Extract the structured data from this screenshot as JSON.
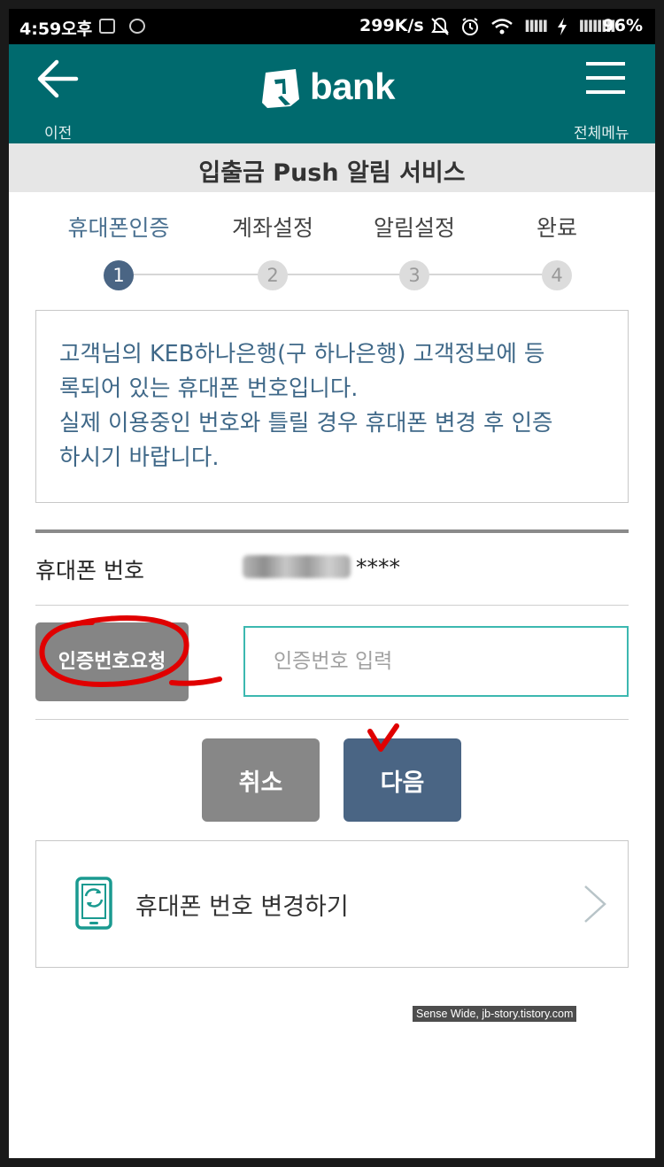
{
  "status_bar": {
    "time": "4:59오후",
    "speed": "299K/s",
    "battery": "96%",
    "signal_text": "IIIII",
    "signal_text2": "IIIIIIII"
  },
  "header": {
    "back_label": "이전",
    "logo_text": "bank",
    "logo_mark": "Q",
    "menu_label": "전체메뉴"
  },
  "page_title": "입출금 Push 알림 서비스",
  "steps": [
    {
      "label": "휴대폰인증",
      "number": "1",
      "active": true
    },
    {
      "label": "계좌설정",
      "number": "2",
      "active": false
    },
    {
      "label": "알림설정",
      "number": "3",
      "active": false
    },
    {
      "label": "완료",
      "number": "4",
      "active": false
    }
  ],
  "info": {
    "line1": "고객님의 KEB하나은행(구 하나은행) 고객정보에 등",
    "line2": "록되어 있는 휴대폰 번호입니다.",
    "line3": "실제 이용중인 번호와 틀릴 경우 휴대폰 변경 후 인증",
    "line4": "하시기 바랍니다."
  },
  "phone": {
    "label": "휴대폰 번호",
    "masked_suffix": "****"
  },
  "verify": {
    "request_label": "인증번호요청",
    "input_placeholder": "인증번호 입력",
    "input_value": ""
  },
  "actions": {
    "cancel_label": "취소",
    "next_label": "다음"
  },
  "change_phone": {
    "label": "휴대폰 번호 변경하기"
  },
  "watermark": "Sense Wide, jb-story.tistory.com",
  "colors": {
    "header_bg": "#006a6e",
    "active_step": "#4a6584",
    "info_text": "#3f6888",
    "input_border": "#3cb8b0",
    "annotation_red": "#e00000"
  },
  "icons": {
    "back": "arrow-left-icon",
    "menu": "hamburger-icon",
    "phone": "phone-exchange-icon",
    "chevron": "chevron-right-icon",
    "silent": "bell-off-icon",
    "alarm": "alarm-clock-icon",
    "wifi": "wifi-icon",
    "charging": "lightning-icon"
  }
}
